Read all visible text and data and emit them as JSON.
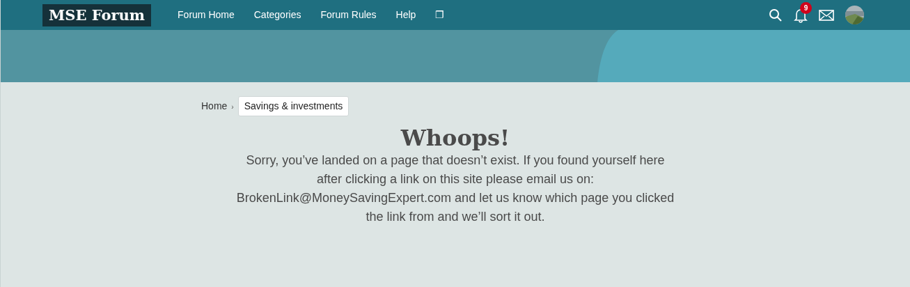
{
  "header": {
    "logo": "MSE Forum",
    "nav": [
      {
        "label": "Forum Home"
      },
      {
        "label": "Categories"
      },
      {
        "label": "Forum Rules"
      },
      {
        "label": "Help"
      },
      {
        "label": "❐"
      }
    ],
    "notifications": {
      "count": "9"
    }
  },
  "breadcrumb_separator": "›",
  "breadcrumb": [
    {
      "label": "Home",
      "current": false
    },
    {
      "label": "Savings & investments",
      "current": true
    }
  ],
  "error": {
    "title": "Whoops!",
    "message": "Sorry, you’ve landed on a page that doesn’t exist. If you found yourself here after clicking a link on this site please email us on: BrokenLink@MoneySavingExpert.com and let us know which page you clicked the link from and we’ll sort it out."
  }
}
